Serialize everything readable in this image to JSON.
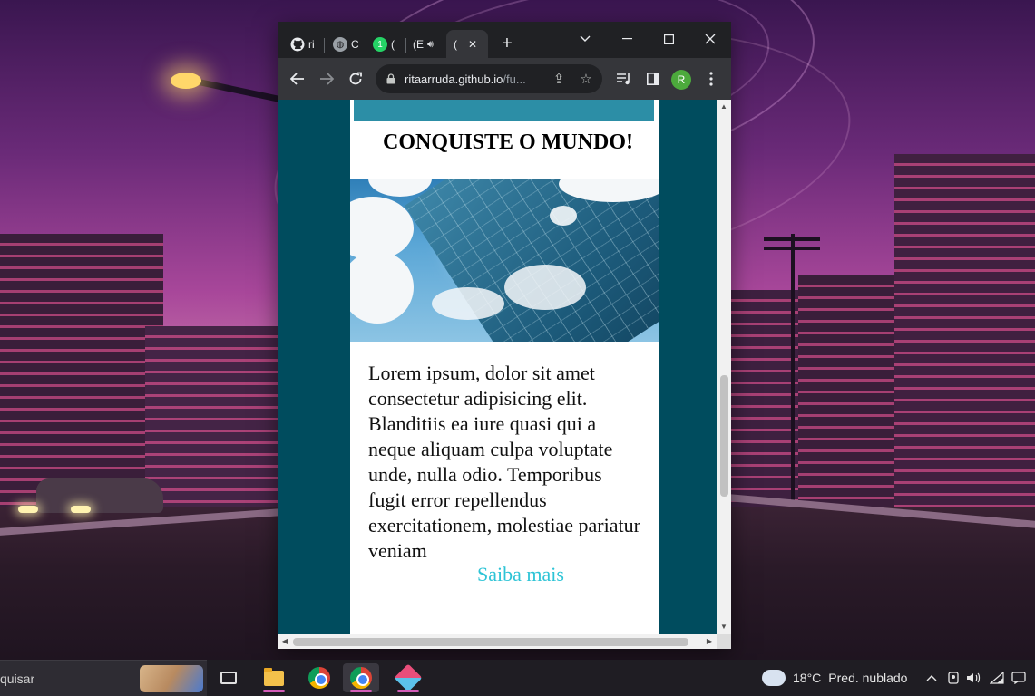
{
  "browser": {
    "tabs": [
      {
        "label": "ri",
        "icon": "github-icon"
      },
      {
        "label": "C",
        "icon": "globe-icon"
      },
      {
        "label": "(",
        "icon": "whatsapp-icon",
        "badge": "1"
      },
      {
        "label": "(E",
        "icon": "audio-icon"
      },
      {
        "label": "(",
        "icon": "loading-icon",
        "active": true
      }
    ],
    "close_tab_glyph": "✕",
    "new_tab_glyph": "+",
    "window_controls": {
      "dropdown": "⌄",
      "minimize": "—",
      "maximize": "☐",
      "close": "✕"
    },
    "url_host": "ritaarruda.github.io",
    "url_path": "/fu...",
    "profile_initial": "R"
  },
  "page": {
    "title": "CONQUISTE O MUNDO!",
    "body_text": "Lorem ipsum, dolor sit amet consectetur adipisicing elit. Blanditiis ea iure quasi qui a neque aliquam culpa voluptate unde, nulla odio. Temporibus fugit error repellendus exercitationem, molestiae pariatur veniam",
    "link_text": "Saiba mais",
    "colors": {
      "background": "#004c5e",
      "card": "#ffffff",
      "accent_bar": "#2c8ea6",
      "link": "#2ec4d6"
    }
  },
  "taskbar": {
    "search_text": "quisar",
    "weather": {
      "temp": "18°C",
      "condition": "Pred. nublado"
    }
  }
}
